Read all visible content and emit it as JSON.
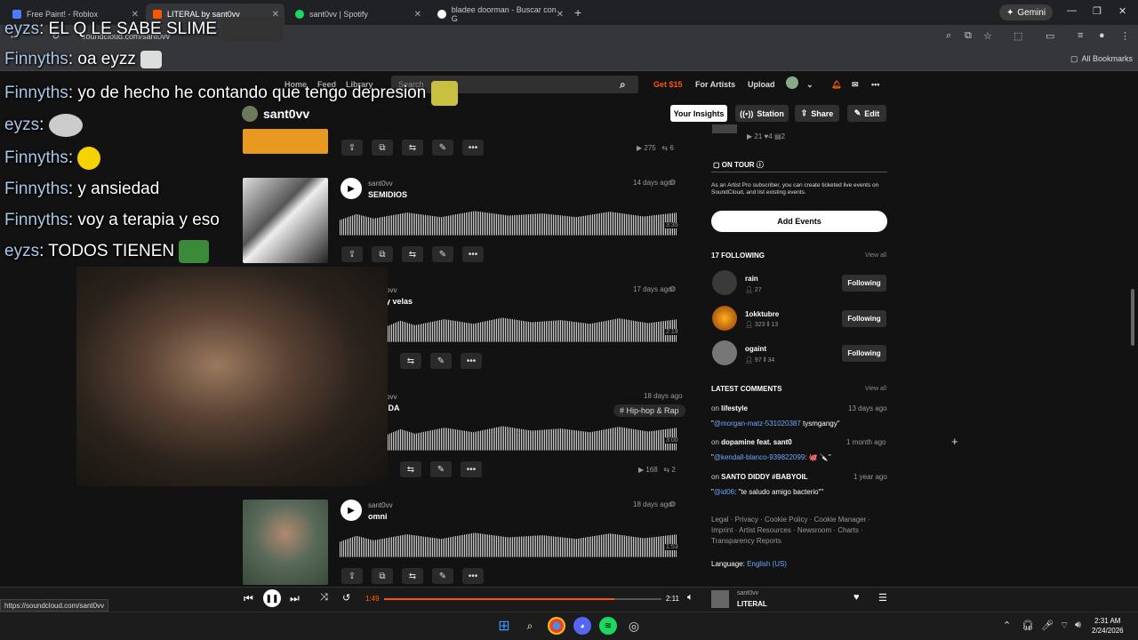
{
  "browser": {
    "tabs": [
      {
        "title": "Free Paint! - Roblox",
        "color": "#4d7cff"
      },
      {
        "title": "LITERAL by sant0vv",
        "color": "#ff5500"
      },
      {
        "title": "sant0vv | Spotify",
        "color": "#1ed760"
      },
      {
        "title": "bladee doorman - Buscar con G",
        "color": "#ffffff"
      }
    ],
    "new_tab": "+",
    "gemini": "Gemini",
    "url": "soundcloud.com/sant0vv",
    "all_bookmarks": "All Bookmarks",
    "status_url": "https://soundcloud.com/sant0vv"
  },
  "soundcloud": {
    "nav": {
      "home": "Home",
      "feed": "Feed",
      "library": "Library",
      "search_placeholder": "Search",
      "get15": "Get $15",
      "for_artists": "For Artists",
      "upload": "Upload"
    },
    "profile": {
      "name": "sant0vv",
      "insights": "Your Insights",
      "station": "Station",
      "share": "Share",
      "edit": "Edit"
    },
    "tracks": [
      {
        "artist": "",
        "title": "",
        "date": "",
        "plays": "275",
        "reposts": "6",
        "art": "#f0a020"
      },
      {
        "artist": "sant0vv",
        "title": "SEMIDIOS",
        "date": "14 days ago",
        "duration": "3:35"
      },
      {
        "artist": "ovv",
        "title": "y velas",
        "date": "17 days ago",
        "duration": "2:19"
      },
      {
        "artist": "ovv",
        "title": "IDA",
        "date": "18 days ago",
        "duration": "3:00",
        "tag": "# Hip-hop & Rap",
        "plays": "168",
        "reposts": "2"
      },
      {
        "artist": "sant0vv",
        "title": "omni",
        "date": "18 days ago",
        "duration": "1:53"
      }
    ],
    "sidebar": {
      "top_stats": {
        "plays": "21",
        "likes": "4",
        "comments": "2"
      },
      "on_tour": "ON TOUR",
      "tour_text_1": "As an Artist Pro subscriber, you can create ticketed live events on",
      "tour_text_2": "SoundCloud, and list existing events.",
      "add_events": "Add Events",
      "following_title": "17 FOLLOWING",
      "view_all": "View all",
      "following": [
        {
          "name": "rain",
          "followers": "27",
          "tracks": "",
          "btn": "Following"
        },
        {
          "name": "1okktubre",
          "followers": "323",
          "tracks": "13",
          "btn": "Following"
        },
        {
          "name": "ogaint",
          "followers": "97",
          "tracks": "34",
          "btn": "Following"
        }
      ],
      "comments_title": "LATEST COMMENTS",
      "comments": [
        {
          "on": "lifestyle",
          "time": "13 days ago",
          "user": "@morgan-matz-531020387",
          "text": "tysmgangy"
        },
        {
          "on": "dopamine feat. sant0",
          "time": "1 month ago",
          "user": "@kendall-blanco-939822099",
          "text": ": 🐙 🔪"
        },
        {
          "on": "SANTO DIDDY #BABYOIL",
          "time": "1 year ago",
          "user": "@id06",
          "text": ": \"te saludo amigo bacterio\""
        }
      ],
      "footer_1": "Legal · Privacy · Cookie Policy · Cookie Manager ·",
      "footer_2": "Imprint · Artist Resources · Newsroom · Charts ·",
      "footer_3": "Transparency Reports",
      "language_label": "Language:",
      "language": "English (US)"
    },
    "player": {
      "elapsed": "1:49",
      "total": "2:11",
      "progress": 0.83,
      "artist": "sant0vv",
      "title": "LITERAL"
    }
  },
  "chat": [
    {
      "user": "eyzs",
      "msg": "EL Q LE SABE SLIME"
    },
    {
      "user": "Finnyths",
      "msg": "oa eyzz"
    },
    {
      "user": "Finnyths",
      "msg": "yo de hecho he contando que tengo depresion"
    },
    {
      "user": "eyzs",
      "msg": ""
    },
    {
      "user": "Finnyths",
      "msg": ""
    },
    {
      "user": "Finnyths",
      "msg": "y ansiedad"
    },
    {
      "user": "Finnyths",
      "msg": "voy a terapia y eso"
    },
    {
      "user": "eyzs",
      "msg": "TODOS TIENEN"
    }
  ],
  "taskbar": {
    "time": "2:31 AM",
    "date": "2/24/2026"
  }
}
